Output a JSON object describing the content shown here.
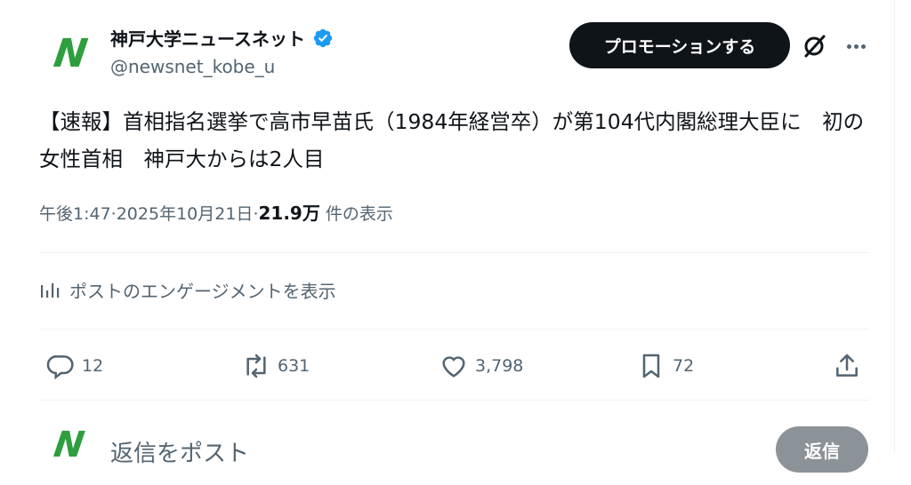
{
  "author": {
    "name": "神戸大学ニュースネット",
    "handle": "@newsnet_kobe_u",
    "avatar_letter": "N"
  },
  "promo_button": "プロモーションする",
  "tweet": {
    "text": "【速報】首相指名選挙で高市早苗氏（1984年経営卒）が第104代内閣総理大臣に　初の女性首相　神戸大からは2人目"
  },
  "meta": {
    "time": "午後1:47",
    "sep": " · ",
    "date": "2025年10月21日",
    "views": "21.9万",
    "views_label": "件の表示"
  },
  "engagement_link": "ポストのエンゲージメントを表示",
  "actions": {
    "replies": "12",
    "reposts": "631",
    "likes": "3,798",
    "bookmarks": "72"
  },
  "reply": {
    "placeholder": "返信をポスト",
    "button": "返信"
  },
  "colors": {
    "text_primary": "#0f1419",
    "text_secondary": "#536471",
    "verified": "#1d9bf0",
    "brand_green": "#2e9e3e"
  },
  "icons": [
    "verified-badge-icon",
    "grok-icon",
    "more-icon",
    "analytics-icon",
    "reply-icon",
    "repost-icon",
    "like-icon",
    "bookmark-icon",
    "share-icon"
  ]
}
